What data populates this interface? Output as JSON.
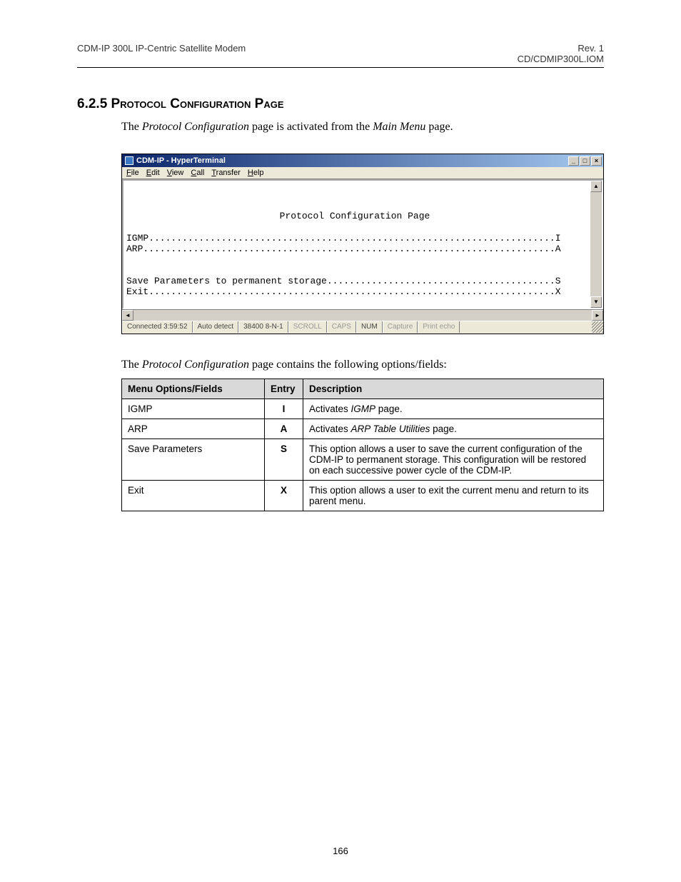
{
  "header": {
    "left": "CDM-IP 300L IP-Centric Satellite Modem",
    "right_line1": "Rev. 1",
    "right_line2": "CD/CDMIP300L.IOM"
  },
  "section": {
    "number": "6.2.5",
    "title": "Protocol Configuration Page",
    "intro_prefix": "The ",
    "intro_em1": "Protocol Configuration",
    "intro_mid": " page is activated from the ",
    "intro_em2": "Main Menu",
    "intro_suffix": " page."
  },
  "terminal": {
    "title": "CDM-IP - HyperTerminal",
    "menus": [
      "File",
      "Edit",
      "View",
      "Call",
      "Transfer",
      "Help"
    ],
    "screen_title": "Protocol Configuration Page",
    "lines": [
      {
        "label": "IGMP",
        "key": "I"
      },
      {
        "label": "ARP",
        "key": "A"
      }
    ],
    "lines2": [
      {
        "label": "Save Parameters to permanent storage",
        "key": "S"
      },
      {
        "label": "Exit",
        "key": "X"
      }
    ],
    "status": {
      "connected": "Connected 3:59:52",
      "detect": "Auto detect",
      "baud": "38400 8-N-1",
      "scroll": "SCROLL",
      "caps": "CAPS",
      "num": "NUM",
      "capture": "Capture",
      "printecho": "Print echo"
    }
  },
  "para2_prefix": "The ",
  "para2_em": "Protocol Configuration",
  "para2_suffix": " page contains the following options/fields:",
  "table": {
    "headers": [
      "Menu Options/Fields",
      "Entry",
      "Description"
    ],
    "rows": [
      {
        "menu": "IGMP",
        "entry": "I",
        "desc_prefix": "Activates ",
        "desc_em": "IGMP",
        "desc_suffix": " page."
      },
      {
        "menu": "ARP",
        "entry": "A",
        "desc_prefix": "Activates ",
        "desc_em": "ARP Table Utilities",
        "desc_suffix": " page."
      },
      {
        "menu": "Save Parameters",
        "entry": "S",
        "desc_plain": "This option allows a user to save the current configuration of the CDM-IP to permanent storage. This configuration will be restored on each successive power cycle of the CDM-IP."
      },
      {
        "menu": "Exit",
        "entry": "X",
        "desc_plain": "This option allows a user to exit the current menu and return to its parent menu."
      }
    ]
  },
  "page_number": "166"
}
